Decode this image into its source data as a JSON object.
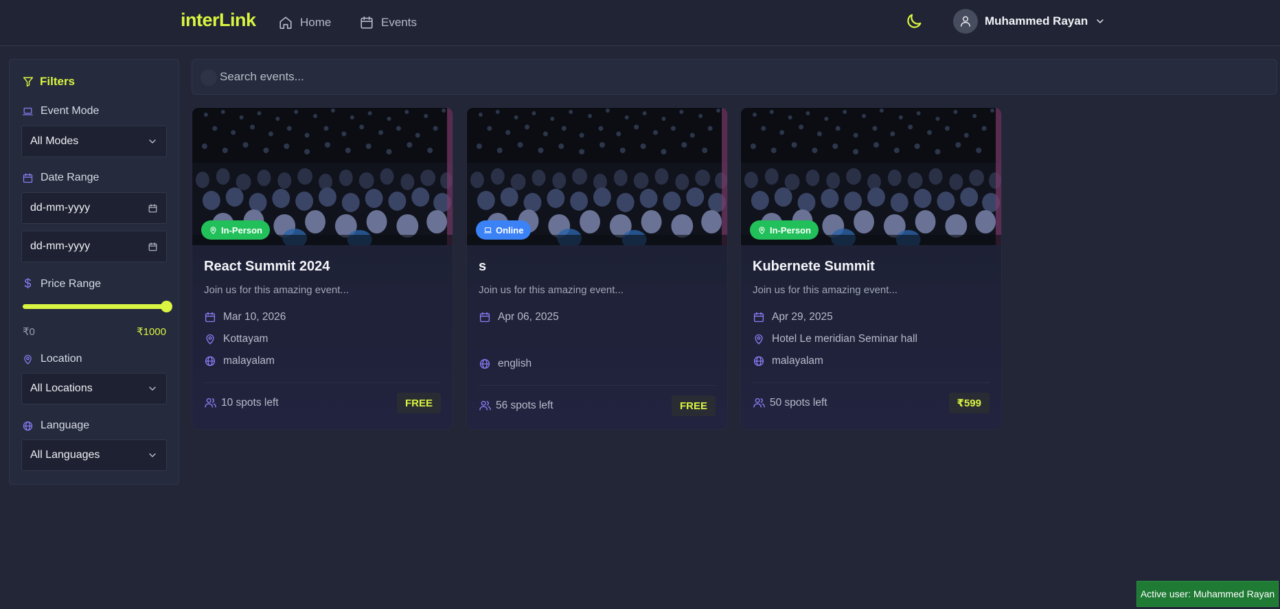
{
  "header": {
    "logo": "interLink",
    "nav": [
      {
        "label": "Home",
        "icon": "home-icon"
      },
      {
        "label": "Events",
        "icon": "calendar-icon"
      }
    ],
    "theme_icon": "moon-icon",
    "user_name": "Muhammed Rayan"
  },
  "sidebar": {
    "title": "Filters",
    "event_mode": {
      "label": "Event Mode",
      "value": "All Modes"
    },
    "date_range": {
      "label": "Date Range",
      "start_placeholder": "dd-mm-yyyy",
      "end_placeholder": "dd-mm-yyyy"
    },
    "price_range": {
      "label": "Price Range",
      "min_label": "₹0",
      "max_label": "₹1000",
      "level": 1.0
    },
    "location": {
      "label": "Location",
      "value": "All Locations"
    },
    "language": {
      "label": "Language",
      "value": "All Languages"
    }
  },
  "search": {
    "placeholder": "Search events..."
  },
  "events": [
    {
      "mode": "In-Person",
      "title": "React Summit 2024",
      "description": "Join us for this amazing event...",
      "date": "Mar 10, 2026",
      "location": "Kottayam",
      "language": "malayalam",
      "spots": "10 spots left",
      "price": "FREE"
    },
    {
      "mode": "Online",
      "title": "s",
      "description": "Join us for this amazing event...",
      "date": "Apr 06, 2025",
      "language": "english",
      "spots": "56 spots left",
      "price": "FREE"
    },
    {
      "mode": "In-Person",
      "title": "Kubernete Summit",
      "description": "Join us for this amazing event...",
      "date": "Apr 29, 2025",
      "location": "Hotel Le meridian Seminar hall",
      "language": "malayalam",
      "spots": "50 spots left",
      "price": "₹599"
    }
  ],
  "toast": "Active user: Muhammed Rayan",
  "colors": {
    "accent": "#d9f542",
    "icon_purple": "#8b7cf6",
    "in_person_badge": "#22c05a",
    "online_badge": "#3b82f6"
  }
}
